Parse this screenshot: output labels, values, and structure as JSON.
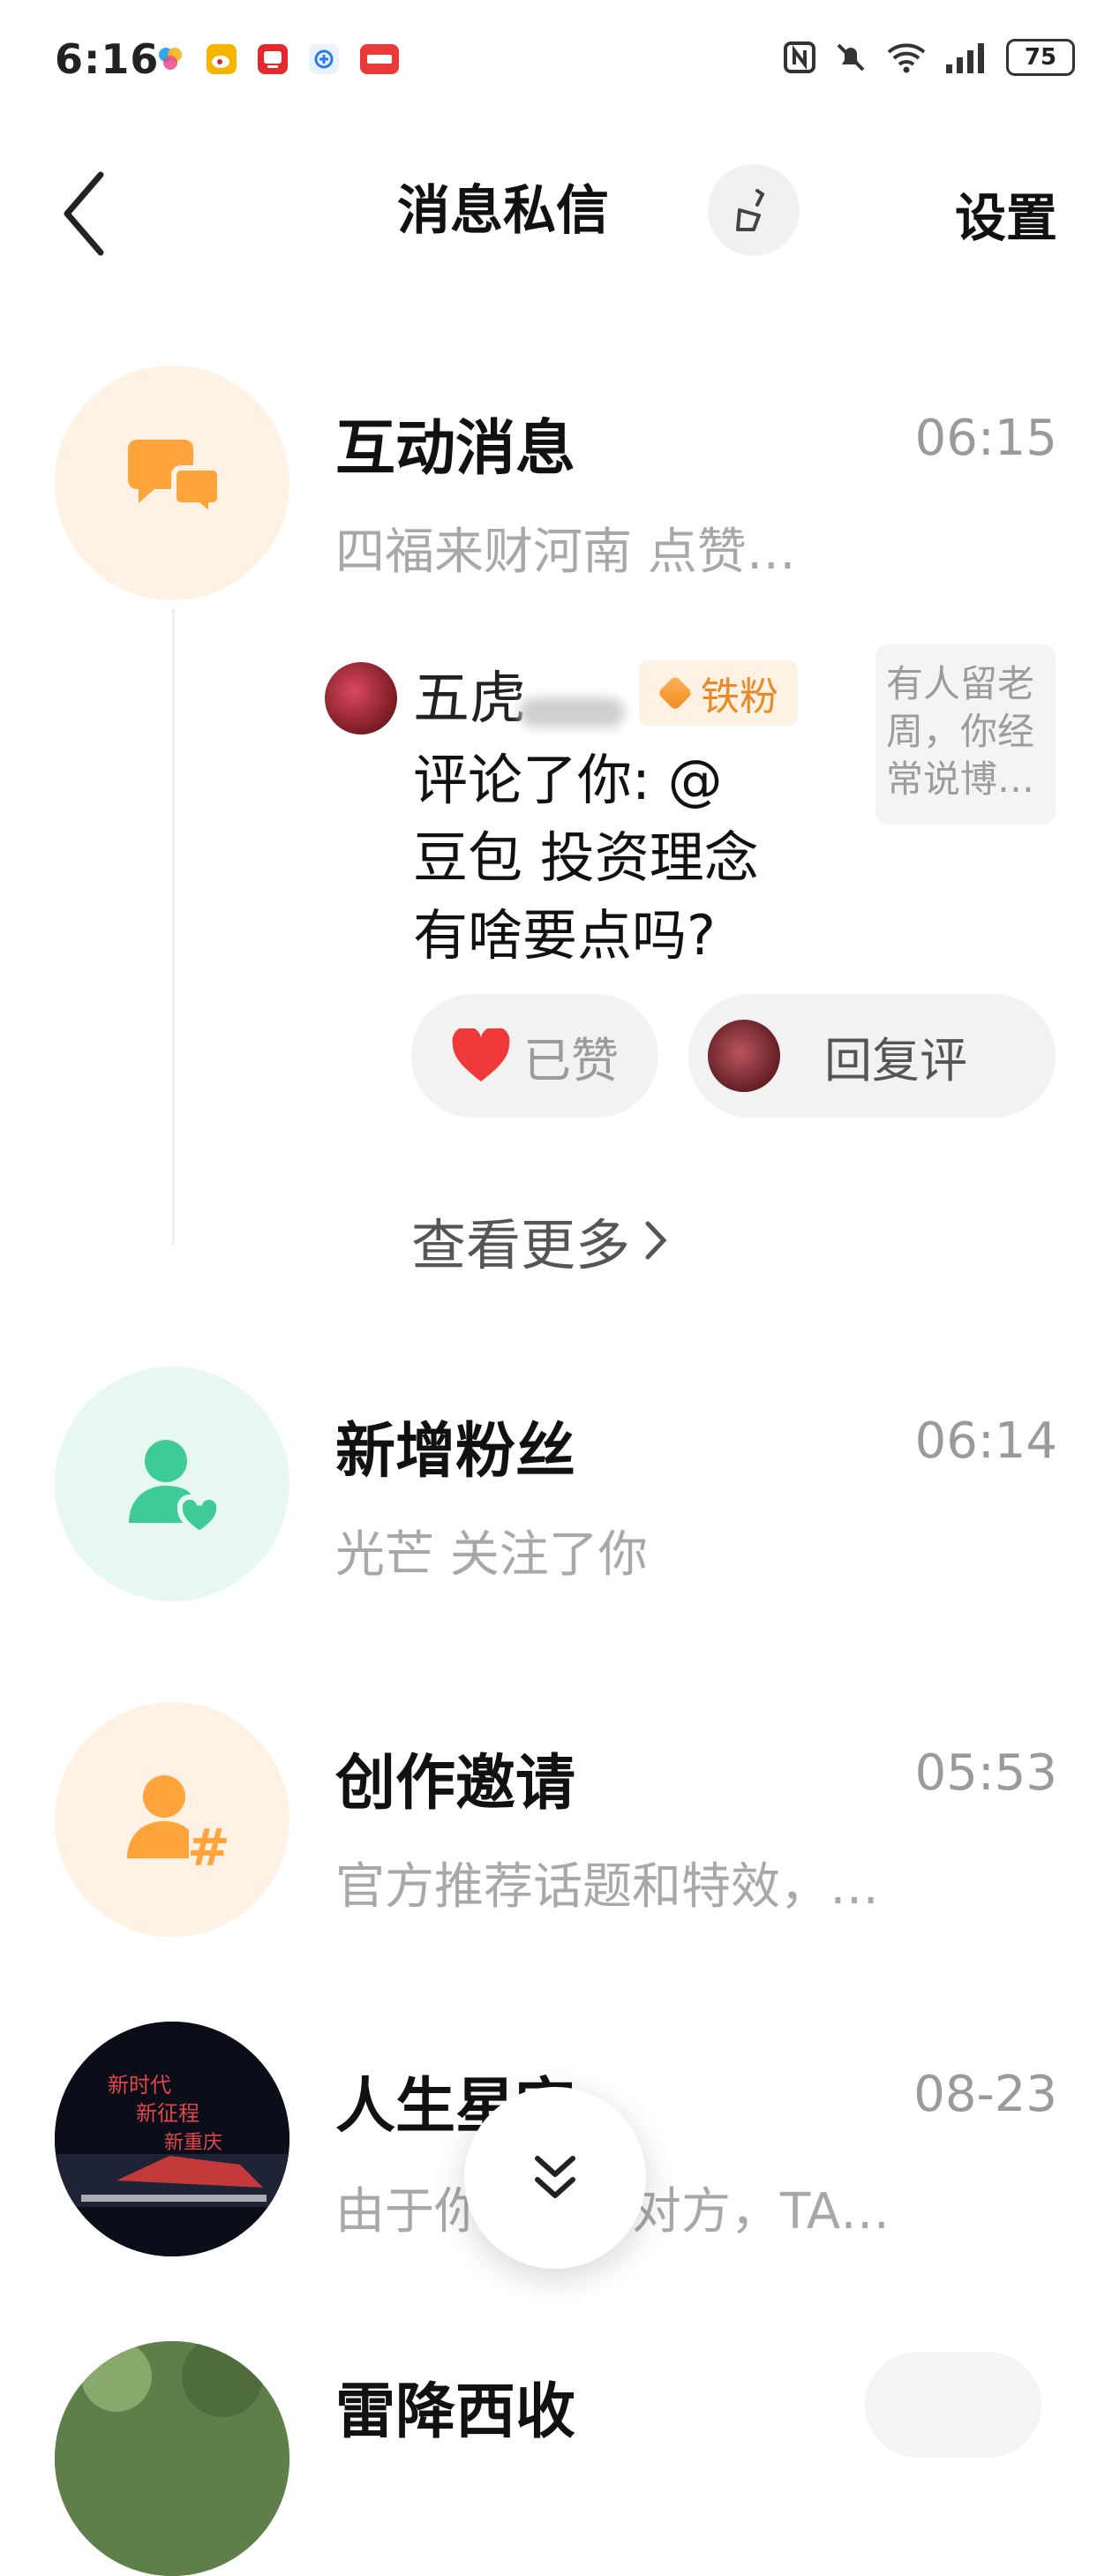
{
  "status_bar": {
    "time": "6:16",
    "battery": "75",
    "colors": {
      "weibo": "#f5b400",
      "tv": "#e3292e",
      "toutiao": "#e83a3a"
    },
    "icons": [
      "multicolor-app-icon",
      "weibo-icon",
      "tv-app-icon",
      "browser-icon",
      "toutiao-icon",
      "nfc-icon",
      "mute-bell-icon",
      "wifi-icon",
      "signal-icon",
      "battery-icon"
    ]
  },
  "header": {
    "title": "消息私信",
    "settings_label": "设置",
    "back_icon": "back-chevron-icon",
    "clean_icon": "broom-icon"
  },
  "interaction": {
    "title": "互动消息",
    "time": "06:15",
    "subtitle": "四福来财河南 点赞…",
    "icon_color": "#ffa43a",
    "bg_color": "#fff1e4",
    "comment": {
      "name": "五虎",
      "badge": "铁粉",
      "text_lines": [
        "评论了你: @",
        "豆包 投资理念",
        "有啥要点吗?"
      ],
      "thumb_lines": [
        "有人留老",
        "周，你经",
        "常说博…"
      ],
      "like_label": "已赞",
      "reply_label": "回复评"
    },
    "see_more": "查看更多"
  },
  "rows": [
    {
      "title": "新增粉丝",
      "time": "06:14",
      "subtitle": "光芒 关注了你",
      "bg_color": "#e6f8f1",
      "icon_color": "#3ecb95"
    },
    {
      "title": "创作邀请",
      "time": "05:53",
      "subtitle": "官方推荐话题和特效，…",
      "bg_color": "#fff1e4",
      "icon_color": "#ffa43a"
    },
    {
      "title": "人生星空",
      "time": "08-23",
      "subtitle": "由于你未关注对方，TA…",
      "bg_color": "#111111"
    },
    {
      "title": "雷降西收",
      "time": "",
      "subtitle": "",
      "bg_color": "#6e8e57"
    }
  ],
  "avatar_text": [
    "新时代",
    "新征程",
    "新重庆"
  ]
}
